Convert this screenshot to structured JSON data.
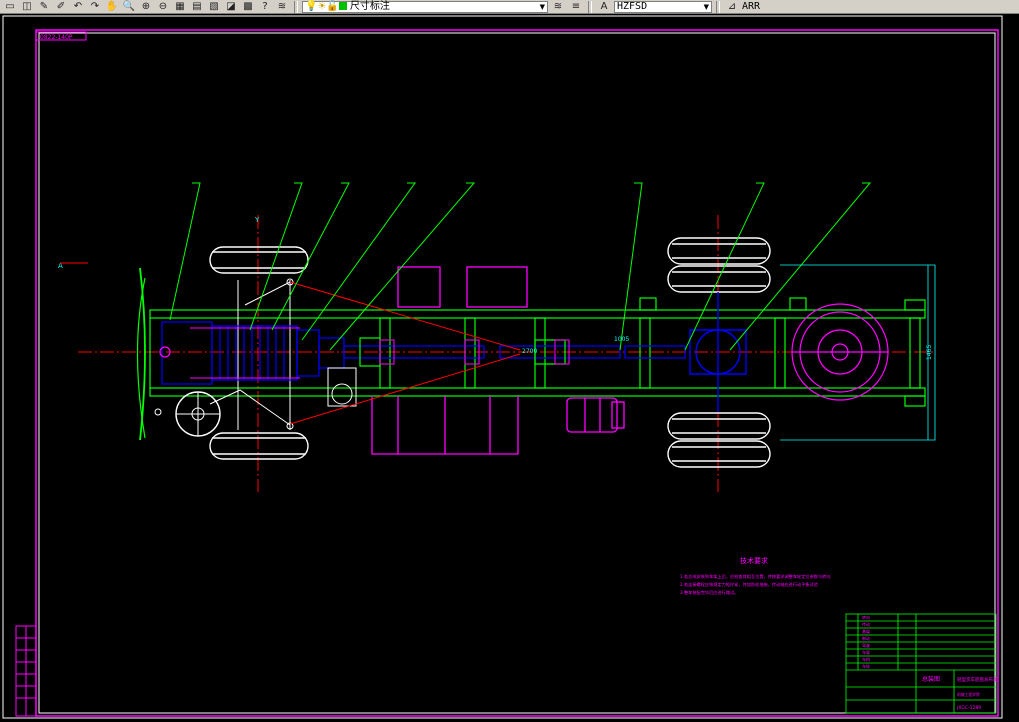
{
  "toolbar": {
    "buttons": [
      {
        "name": "open-icon",
        "glyph": "▭"
      },
      {
        "name": "save-icon",
        "glyph": "◫"
      },
      {
        "name": "pencil-icon",
        "glyph": "✎"
      },
      {
        "name": "brush-icon",
        "glyph": "✐"
      },
      {
        "name": "undo-icon",
        "glyph": "↶"
      },
      {
        "name": "redo-icon",
        "glyph": "↷"
      },
      {
        "name": "pan-hand-icon",
        "glyph": "✋"
      },
      {
        "name": "zoom-realtime-icon",
        "glyph": "🔍"
      },
      {
        "name": "zoom-window-icon",
        "glyph": "⊕"
      },
      {
        "name": "zoom-previous-icon",
        "glyph": "⊖"
      },
      {
        "name": "properties-icon",
        "glyph": "▦"
      },
      {
        "name": "design-center-icon",
        "glyph": "▤"
      },
      {
        "name": "tool-palette-icon",
        "glyph": "▧"
      },
      {
        "name": "markup-icon",
        "glyph": "◪"
      },
      {
        "name": "calculator-icon",
        "glyph": "▩"
      },
      {
        "name": "help-icon",
        "glyph": "?"
      },
      {
        "name": "layer-manager-icon",
        "glyph": "≋"
      }
    ],
    "layer_name": "尺寸标注",
    "style_name": "HZFSD",
    "right_label": "ARR"
  },
  "drawing": {
    "top_left_tag": "0822-140P",
    "notes_heading": "技术要求",
    "notes_lines": [
      "1.各总成安装到车架上后，应检查其相互位置，并按要求调整车轮定位参数与转向",
      "2.各连接螺栓应按规定力矩拧紧，并加防松措施，传动轴应进行动平衡试验",
      "3.整车装配完毕后应进行路试。"
    ],
    "title_block": {
      "part_name": "总装图",
      "design_title": "轻型货车底盘总布置",
      "drawing_number": "JXGC-1289",
      "school": "机械工程学院",
      "row_labels": [
        "转向",
        "传动",
        "悬架",
        "制动",
        "驾驶",
        "车架",
        "车桥",
        "车轮"
      ]
    },
    "dim_labels": {
      "wheelbase_marker": "2700",
      "rear_track": "1465",
      "shaft_length": "1005",
      "section_mark": "A",
      "front_mark": "Y"
    }
  },
  "colors": {
    "frame": "#00ff00",
    "engine": "#0000ff",
    "wheels": "#ffffff",
    "tanks": "#ff00ff",
    "centerline": "#ff0000",
    "dims": "#00ffff",
    "leaders": "#00ff00"
  }
}
